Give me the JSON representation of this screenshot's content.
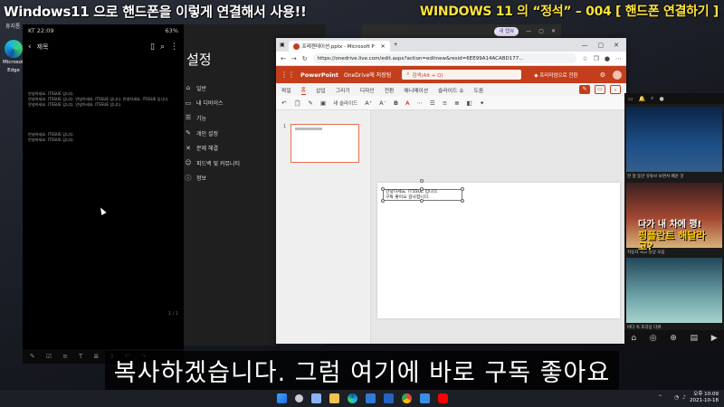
{
  "banner": {
    "left_title": "Windows11 으로 핸드폰을 이렇게 연결해서 사용!!",
    "right_title": "WINDOWS 11 의 “정석” – 004 [ 핸드폰 연결하기 ]"
  },
  "desktop": {
    "top_label": "휴지통",
    "edge_label_1": "Microsoft",
    "edge_label_2": "Edge"
  },
  "phone": {
    "status_left": "KT 22:09",
    "status_right": "63%",
    "toolbar_title": "제목",
    "note_block_1": [
      "안녕하세요. ITSSUE 입니다.",
      "안녕하세요. ITSSUE 입니다. 안녕하세요. ITSSUE 입니다. 안녕하세요. ITSSUE 입니다.",
      "안녕하세요. ITSSUE 입니다. 안녕하세요. ITSSUE 입니다."
    ],
    "note_block_2": [
      "안녕하세요. ITSSUE 입니다.",
      "안녕하세요. ITSSUE 입니다."
    ],
    "page_indicator": "1 / 1",
    "bottom_num": "9"
  },
  "settings": {
    "title": "설정",
    "items": [
      {
        "icon": "home-icon",
        "glyph": "⌂",
        "label": "일반"
      },
      {
        "icon": "devices-icon",
        "glyph": "▭",
        "label": "내 디바이스"
      },
      {
        "icon": "list-icon",
        "glyph": "☰",
        "label": "기능"
      },
      {
        "icon": "palette-icon",
        "glyph": "✎",
        "label": "개인 설정"
      },
      {
        "icon": "wrench-icon",
        "glyph": "✕",
        "label": "문제 해결"
      },
      {
        "icon": "feedback-icon",
        "glyph": "☺",
        "label": "피드백 및 커뮤니티"
      },
      {
        "icon": "info-icon",
        "glyph": "ⓘ",
        "label": "정보"
      }
    ]
  },
  "chip_window": {
    "chip_label": "새 탭뷰"
  },
  "browser": {
    "tab_title": "프레젠테이션.pptx - Microsoft P",
    "url": "https://onedrive.live.com/edit.aspx?action=editnew&resid=6EE99A14ACABD177...",
    "app_name": "PowerPoint",
    "breadcrumb": "OneDrive에 저장됨",
    "search_placeholder": "검색(Alt + Q)",
    "premium_label": "프리미엄으로 전환",
    "ribbon_tabs": [
      "파일",
      "홈",
      "삽입",
      "그리기",
      "디자인",
      "전환",
      "애니메이션",
      "슬라이드 쇼",
      "도움"
    ],
    "active_tab": "홈",
    "new_slide_label": "새 슬라이드",
    "slide_number": "1",
    "textbox_lines": [
      "안녕하세요. ITSSUE 입니다.",
      "구독 좋아요 감사합니다."
    ],
    "accent": "#c43e1c"
  },
  "youtube": {
    "overlay_line_1": "다가 내 차에 평!",
    "overlay_line_2": "핑플란트 해달라고?",
    "caption_1": "한 달 동안 유튜브 보면서 배운 것",
    "caption_2": "자동차 사고 영상 모음",
    "caption_3": "바다 속 조각상 다큐"
  },
  "subtitle": "복사하겠습니다. 그럼 여기에 바로 구독 좋아요",
  "tray": {
    "time": "오후 10:09",
    "date": "2021-10-18"
  }
}
